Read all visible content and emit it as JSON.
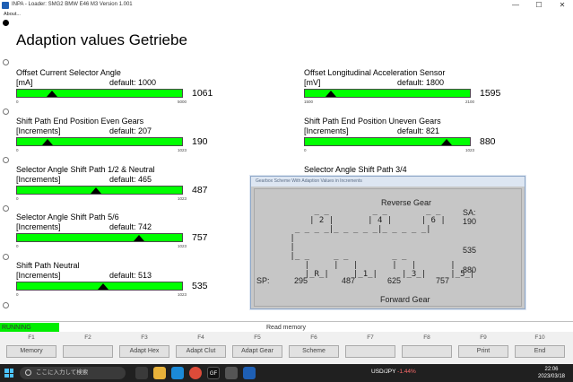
{
  "window": {
    "title": "INPA - Loader:  SMG2 BMW E46 M3 Version 1.001",
    "menu": "About...",
    "controls": {
      "minimize": "—",
      "maximize": "☐",
      "close": "✕"
    }
  },
  "page_title": "Adaption values Getriebe",
  "gauges": [
    {
      "title": "Offset Current Selector Angle",
      "unit": "[mA]",
      "default": "default: 1000",
      "value": "1061",
      "min": "0",
      "max": "5000",
      "level": 0.2122
    },
    {
      "title": "Offset Longitudinal Acceleration Sensor",
      "unit": "[mV]",
      "default": "default: 1800",
      "value": "1595",
      "min": "1500",
      "max": "2100",
      "level": 0.1583
    },
    {
      "title": "Shift Path End Position Even Gears",
      "unit": "[Increments]",
      "default": "default: 207",
      "value": "190",
      "min": "0",
      "max": "1023",
      "level": 0.1857
    },
    {
      "title": "Shift Path End Position Uneven Gears",
      "unit": "[Increments]",
      "default": "default: 821",
      "value": "880",
      "min": "0",
      "max": "1023",
      "level": 0.8602
    },
    {
      "title": "Selector Angle Shift Path 1/2 & Neutral",
      "unit": "[Increments]",
      "default": "default: 465",
      "value": "487",
      "min": "0",
      "max": "1023",
      "level": 0.476
    },
    {
      "title": "Selector Angle Shift Path 3/4",
      "unit": "",
      "default": "",
      "value": "",
      "min": "",
      "max": "",
      "level": null
    },
    {
      "title": "Selector Angle Shift Path 5/6",
      "unit": "[Increments]",
      "default": "default: 742",
      "value": "757",
      "min": "0",
      "max": "1023",
      "level": 0.74
    },
    {
      "title": "Shift Path Neutral",
      "unit": "[Increments]",
      "default": "default: 513",
      "value": "535",
      "min": "0",
      "max": "1023",
      "level": 0.523
    }
  ],
  "dialog": {
    "title": "Gearbox Scheme With Adaption Values in Increments",
    "reverse_label": "Reverse Gear",
    "forward_label": "Forward Gear",
    "sa_label": "SA:",
    "sa_values": [
      "190",
      "535",
      "880"
    ],
    "sp_label": "SP:",
    "sp_values": [
      "295",
      "487",
      "625",
      "757"
    ],
    "scheme_text": "      _ _         _ _        _ _\n     | 2 |       | 4 |      | 6 |\n  _ _ _ _|_ _ _ _ _|_ _ _ _ _|\n |\n |\n |_ _     _ _         _ _\n    |     |   |       |   |       |\n    |_R_|     |_1_|     |_3_|     |_5_|"
  },
  "status": {
    "running": "RUNNING",
    "message": "Read memory"
  },
  "fkeys": [
    {
      "key": "F1",
      "label": "Memory"
    },
    {
      "key": "F2",
      "label": ""
    },
    {
      "key": "F3",
      "label": "Adapt Hex"
    },
    {
      "key": "F4",
      "label": "Adapt Clut"
    },
    {
      "key": "F5",
      "label": "Adapt Gear"
    },
    {
      "key": "F6",
      "label": "Scheme"
    },
    {
      "key": "F7",
      "label": ""
    },
    {
      "key": "F8",
      "label": ""
    },
    {
      "key": "F9",
      "label": "Print"
    },
    {
      "key": "F10",
      "label": "End"
    }
  ],
  "taskbar": {
    "search_placeholder": "ここに入力して検索",
    "ticker_symbol": "USD/JPY",
    "ticker_change": "-1.44%",
    "time": "22:06",
    "date": "2023/03/18",
    "apps": [
      "",
      "",
      "",
      "",
      "GF",
      "",
      ""
    ]
  },
  "colors": {
    "gauge_fill": "#00ff00",
    "running": "#00ee00",
    "dialog_bg": "#c8c8c8"
  }
}
